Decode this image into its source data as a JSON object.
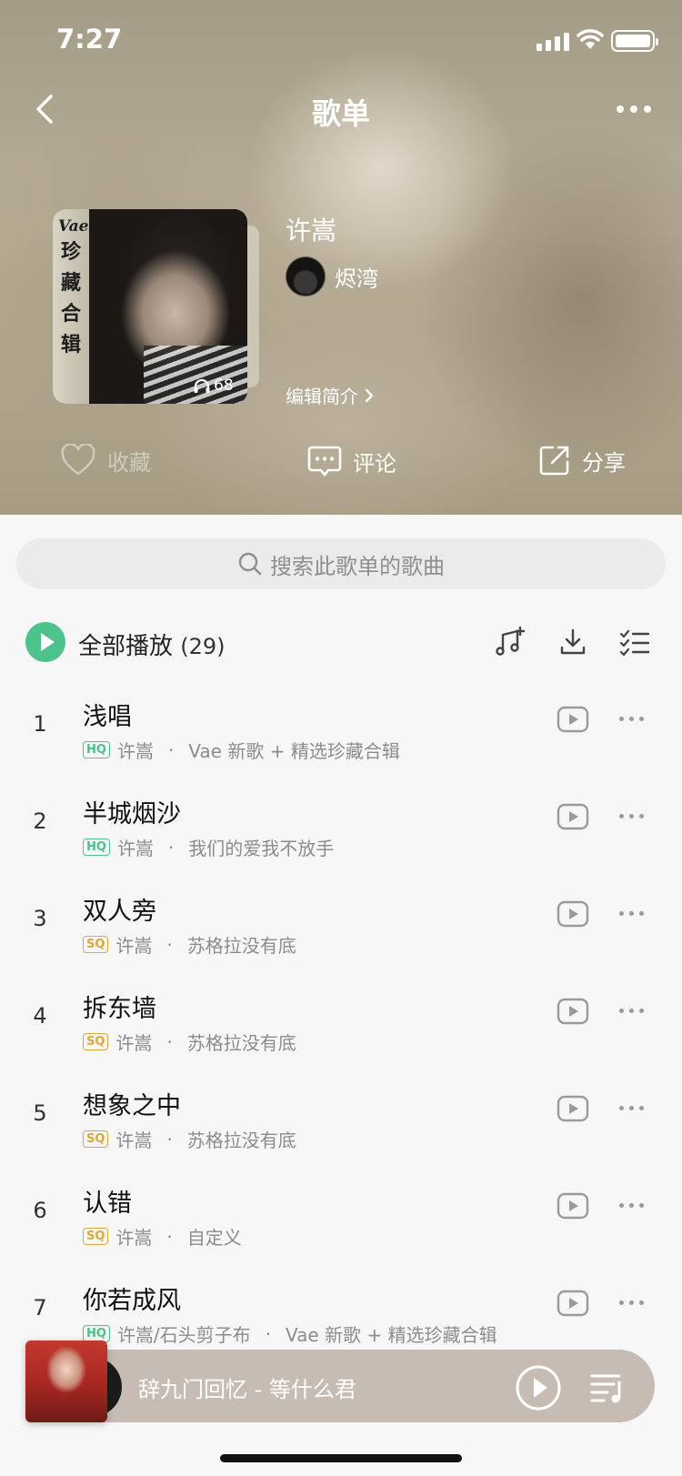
{
  "status_bar": {
    "time": "7:27"
  },
  "nav": {
    "title": "歌单"
  },
  "playlist": {
    "title": "许嵩",
    "creator": "烬湾",
    "play_count": "68",
    "edit_intro": "编辑简介",
    "cover_text": [
      "Vae",
      "珍",
      "藏",
      "合",
      "辑"
    ]
  },
  "actions": {
    "favorite": "收藏",
    "comment": "评论",
    "share": "分享"
  },
  "search": {
    "placeholder": "搜索此歌单的歌曲"
  },
  "play_all": {
    "label": "全部播放",
    "count": "(29)"
  },
  "songs": [
    {
      "index": "1",
      "title": "浅唱",
      "quality": "HQ",
      "artist": "许嵩",
      "album": "Vae 新歌 + 精选珍藏合辑"
    },
    {
      "index": "2",
      "title": "半城烟沙",
      "quality": "HQ",
      "artist": "许嵩",
      "album": "我们的爱我不放手"
    },
    {
      "index": "3",
      "title": "双人旁",
      "quality": "SQ",
      "artist": "许嵩",
      "album": "苏格拉没有底"
    },
    {
      "index": "4",
      "title": "拆东墙",
      "quality": "SQ",
      "artist": "许嵩",
      "album": "苏格拉没有底"
    },
    {
      "index": "5",
      "title": "想象之中",
      "quality": "SQ",
      "artist": "许嵩",
      "album": "苏格拉没有底"
    },
    {
      "index": "6",
      "title": "认错",
      "quality": "SQ",
      "artist": "许嵩",
      "album": "自定义"
    },
    {
      "index": "7",
      "title": "你若成风",
      "quality": "HQ",
      "artist": "许嵩/石头剪子布",
      "album": "Vae 新歌 + 精选珍藏合辑"
    }
  ],
  "mini_player": {
    "title": "辞九门回忆 - 等什么君"
  },
  "colors": {
    "accent_green": "#4cc38a",
    "sq_gold": "#e0a63a",
    "mini_player_bg": "#c7bcb3"
  }
}
